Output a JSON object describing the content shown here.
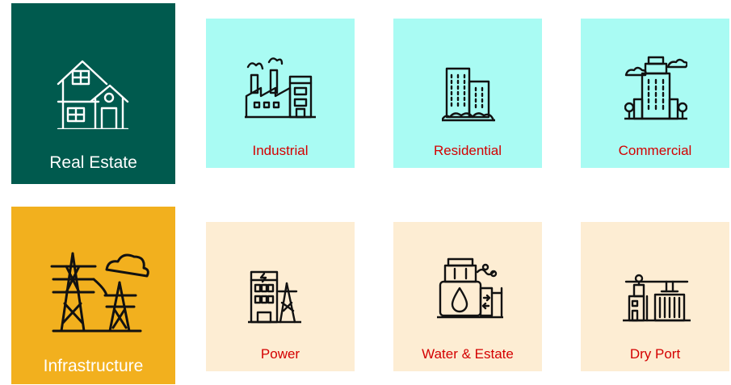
{
  "colors": {
    "real_estate_bg": "#005a4e",
    "real_estate_sub_bg": "#a9fbf3",
    "infrastructure_bg": "#f2b01e",
    "infrastructure_sub_bg": "#fdedd3",
    "sub_label": "#d40000"
  },
  "real_estate": {
    "label": "Real Estate",
    "icon": "house-icon",
    "items": [
      {
        "label": "Industrial",
        "icon": "factory-icon"
      },
      {
        "label": "Residential",
        "icon": "apartment-buildings-icon"
      },
      {
        "label": "Commercial",
        "icon": "office-tower-icon"
      }
    ]
  },
  "infrastructure": {
    "label": "Infrastructure",
    "icon": "power-tower-icon",
    "items": [
      {
        "label": "Power",
        "icon": "power-plant-icon"
      },
      {
        "label": "Water & Estate",
        "icon": "water-tank-icon"
      },
      {
        "label": "Dry Port",
        "icon": "port-crane-icon"
      }
    ]
  }
}
